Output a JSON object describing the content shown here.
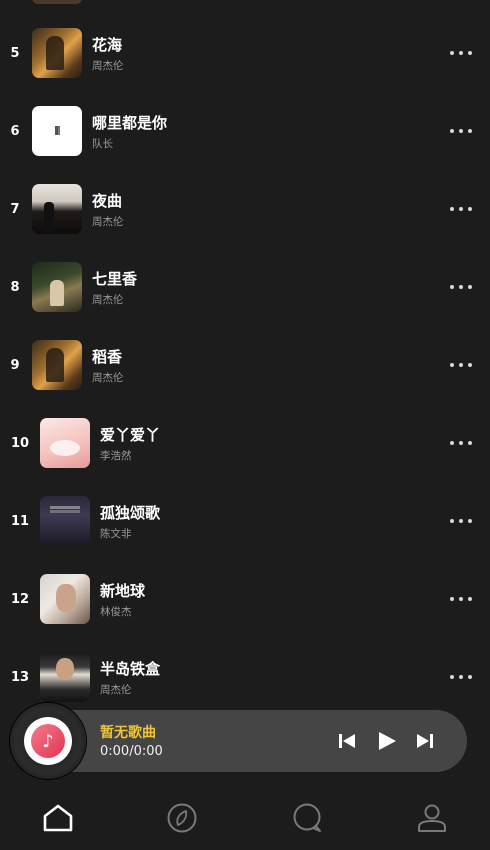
{
  "songs": [
    {
      "rank": "5",
      "title": "花海",
      "artist": "周杰伦",
      "cover": "warm"
    },
    {
      "rank": "6",
      "title": "哪里都是你",
      "artist": "队长",
      "cover": "white"
    },
    {
      "rank": "7",
      "title": "夜曲",
      "artist": "周杰伦",
      "cover": "dark"
    },
    {
      "rank": "8",
      "title": "七里香",
      "artist": "周杰伦",
      "cover": "green"
    },
    {
      "rank": "9",
      "title": "稻香",
      "artist": "周杰伦",
      "cover": "warm"
    },
    {
      "rank": "10",
      "title": "爱丫爱丫",
      "artist": "李浩然",
      "cover": "pink"
    },
    {
      "rank": "11",
      "title": "孤独颂歌",
      "artist": "陈文非",
      "cover": "night"
    },
    {
      "rank": "12",
      "title": "新地球",
      "artist": "林俊杰",
      "cover": "face"
    },
    {
      "rank": "13",
      "title": "半岛铁盒",
      "artist": "周杰伦",
      "cover": "mag"
    }
  ],
  "player": {
    "title": "暂无歌曲",
    "time": "0:00/0:00",
    "icons": [
      "music-note-icon",
      "skip-previous-icon",
      "play-icon",
      "skip-next-icon"
    ]
  },
  "nav": {
    "icons": [
      "home-icon",
      "explore-icon",
      "chat-icon",
      "user-icon"
    ]
  },
  "colors": {
    "background": "#1c1c1c",
    "player_bar": "#454545",
    "accent_title": "#f0c437",
    "artist_text": "#9a9a9a"
  }
}
